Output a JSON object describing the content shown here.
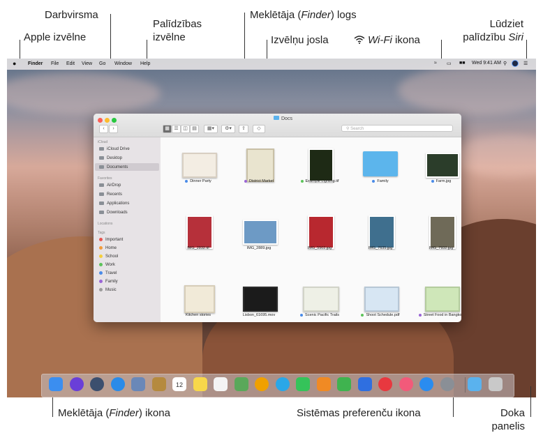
{
  "callouts": {
    "apple_menu": "Apple izvēlne",
    "desktop": "Darbvirsma",
    "help_menu": [
      "Palīdzības",
      "izvēlne"
    ],
    "finder_window": [
      "Meklētāja (",
      "Finder",
      ") logs"
    ],
    "menu_bar": "Izvēlņu josla",
    "wifi_icon": [
      "Wi-Fi",
      " ikona"
    ],
    "ask_siri": [
      "Lūdziet",
      "palīdzību ",
      "Siri"
    ],
    "finder_icon": [
      "Meklētāja (",
      "Finder",
      ") ikona"
    ],
    "system_prefs_icon": "Sistēmas preferenču ikona",
    "dock": [
      "Doka",
      "panelis"
    ]
  },
  "menubar": {
    "apple": "",
    "items": [
      "Finder",
      "File",
      "Edit",
      "View",
      "Go",
      "Window",
      "Help"
    ],
    "clock": "Wed 9:41 AM"
  },
  "window": {
    "title": "Docs",
    "search_placeholder": "Search",
    "sidebar": {
      "icloud_heading": "iCloud",
      "icloud": [
        "iCloud Drive",
        "Desktop",
        "Documents"
      ],
      "favorites_heading": "Favorites",
      "favorites": [
        "AirDrop",
        "Recents",
        "Applications",
        "Downloads"
      ],
      "locations_heading": "Locations",
      "tags_heading": "Tags",
      "tags": [
        {
          "label": "Important",
          "color": "#e8544e"
        },
        {
          "label": "Home",
          "color": "#f39c3b"
        },
        {
          "label": "School",
          "color": "#f5cf3a"
        },
        {
          "label": "Work",
          "color": "#5cc35a"
        },
        {
          "label": "Travel",
          "color": "#4a8be8"
        },
        {
          "label": "Family",
          "color": "#9a65d6"
        },
        {
          "label": "Music",
          "color": "#9b9b9b"
        }
      ]
    },
    "files": [
      {
        "name": "Dinner Party",
        "tag": "#4a8be8"
      },
      {
        "name": "District Market",
        "tag": "#9a65d6"
      },
      {
        "name": "Example Lighting.tif",
        "tag": "#5cc35a"
      },
      {
        "name": "Family",
        "tag": "#4a8be8"
      },
      {
        "name": "Farm.jpg",
        "tag": "#4a8be8"
      },
      {
        "name": "IMG_2832.tif",
        "tag": ""
      },
      {
        "name": "IMG_2889.jpg",
        "tag": ""
      },
      {
        "name": "IMG_5502.jpg",
        "tag": ""
      },
      {
        "name": "IMG_7635.jpg",
        "tag": ""
      },
      {
        "name": "IMG_7932.jpg",
        "tag": ""
      },
      {
        "name": "Kitchen stories",
        "tag": ""
      },
      {
        "name": "Lisbon_61695.mov",
        "tag": ""
      },
      {
        "name": "Scenic Pacific Trails",
        "tag": "#4a8be8"
      },
      {
        "name": "Shoot Schedule.pdf",
        "tag": "#5cc35a"
      },
      {
        "name": "Street Food in Bangkok",
        "tag": "#9a65d6"
      }
    ]
  },
  "dock": {
    "icons": [
      "finder-icon",
      "siri-icon",
      "launchpad-icon",
      "safari-icon",
      "photos-preview-icon",
      "notes-book-icon",
      "calendar-icon",
      "notes-icon",
      "reminders-icon",
      "maps-icon",
      "photos-icon",
      "messages-icon",
      "facetime-icon",
      "pages-icon",
      "numbers-icon",
      "keynote-icon",
      "news-icon",
      "music-icon",
      "app-store-icon",
      "system-preferences-icon",
      "folder-icon",
      "trash-icon"
    ],
    "calendar_day": "12"
  }
}
